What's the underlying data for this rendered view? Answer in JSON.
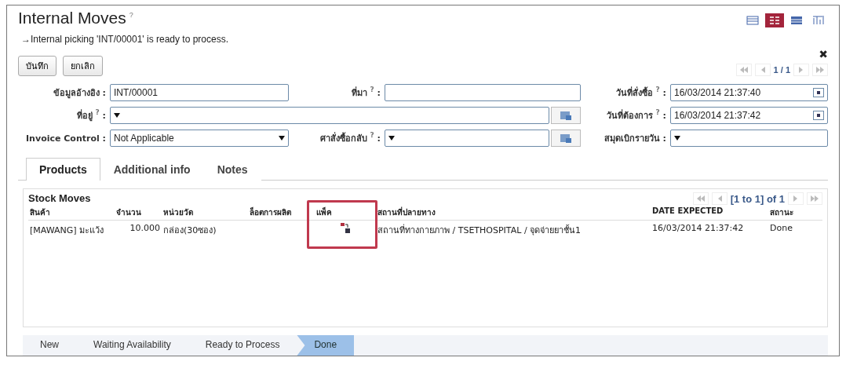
{
  "title": "Internal Moves",
  "title_help": "?",
  "view_switcher": [
    {
      "kind": "list",
      "selected": false
    },
    {
      "kind": "form",
      "selected": true
    },
    {
      "kind": "calendar",
      "selected": false
    },
    {
      "kind": "graph",
      "selected": false
    }
  ],
  "message": "→Internal picking 'INT/00001' is ready to process.",
  "buttons": [
    "บันทึก",
    "ยกเลิก"
  ],
  "close": "✖",
  "pager": "1 / 1",
  "fields": [
    {
      "label": "ข้อมูลอ้างอิง",
      "separator": ":",
      "kind": "text",
      "value": "INT/00001"
    },
    {
      "label": "ที่มา",
      "help": "?",
      "separator": ":",
      "kind": "text"
    },
    {
      "label": "วันที่สั่งซื้อ",
      "help": "?",
      "separator": ":",
      "kind": "date",
      "value": "16/03/2014 21:37:40"
    },
    {
      "label": "ที่อยู่",
      "help": "?",
      "separator": ":",
      "kind": "many2one",
      "wide": true
    },
    {
      "label": "วันที่ต้องการ",
      "help": "?",
      "separator": ":",
      "kind": "date",
      "value": "16/03/2014 21:37:42"
    },
    {
      "label": "Invoice Control",
      "separator": ":",
      "kind": "select",
      "value": "Not Applicable"
    },
    {
      "label": "ศาสั่งซื้อกลับ",
      "help": "?",
      "separator": ":",
      "kind": "many2one"
    },
    {
      "label": "สมุดเบิกรายวัน",
      "separator": ":",
      "kind": "select"
    }
  ],
  "tabs": [
    {
      "label": "Products",
      "selected": true
    },
    {
      "label": "Additional info",
      "selected": false
    },
    {
      "label": "Notes",
      "selected": false
    }
  ],
  "stock_moves": {
    "title": "Stock Moves",
    "pager": "[1 to 1] of 1",
    "columns": [
      {
        "label": "สินค้า"
      },
      {
        "label": "จำนวน"
      },
      {
        "label": "หน่วยวัด"
      },
      {
        "label": "ล็อตการผลิต"
      },
      {
        "label": "แพ็ค",
        "highlighted": true
      },
      {
        "label": "สถานที่ปลายทาง"
      },
      {
        "label": "DATE EXPECTED"
      },
      {
        "label": "สถานะ"
      }
    ],
    "rows": [
      {
        "cells": [
          "[MAWANG] มะแว้ง",
          "10.000",
          "กล่อง(30ซอง)",
          "",
          {
            "kind": "pack_icon"
          },
          "สถานที่ทางกายภาพ / TSETHOSPITAL / จุดจ่ายยาชั้น1",
          "16/03/2014 21:37:42",
          "Done"
        ]
      }
    ]
  },
  "status_steps": [
    {
      "label": "New",
      "selected": false
    },
    {
      "label": "Waiting Availability",
      "selected": false
    },
    {
      "label": "Ready to Process",
      "selected": false
    },
    {
      "label": "Done",
      "selected": true
    }
  ]
}
